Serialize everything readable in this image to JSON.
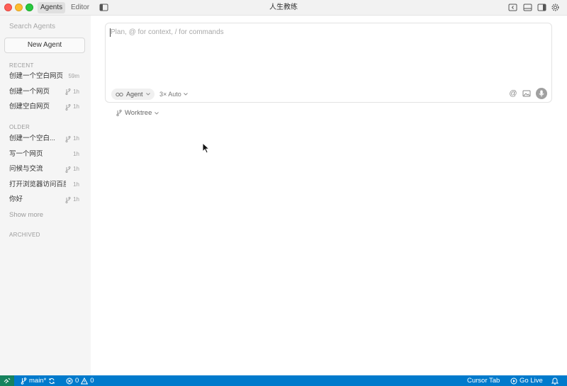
{
  "titlebar": {
    "title": "人生教练",
    "tabs": [
      {
        "label": "Agents",
        "active": true
      },
      {
        "label": "Editor",
        "active": false
      }
    ]
  },
  "sidebar": {
    "search_placeholder": "Search Agents",
    "new_agent_label": "New Agent",
    "sections": {
      "recent": "RECENT",
      "older": "OLDER",
      "archived": "ARCHIVED"
    },
    "recent_items": [
      {
        "label": "创建一个空白网页",
        "time": "59m",
        "branch": false
      },
      {
        "label": "创建一个网页",
        "time": "1h",
        "branch": true
      },
      {
        "label": "创建空白网页",
        "time": "1h",
        "branch": true
      }
    ],
    "older_items": [
      {
        "label": "创建一个空白...",
        "time": "1h",
        "branch": true
      },
      {
        "label": "写一个网页",
        "time": "1h",
        "branch": false
      },
      {
        "label": "问候与交流",
        "time": "1h",
        "branch": true
      },
      {
        "label": "打开浏览器访问百度",
        "time": "1h",
        "branch": false
      },
      {
        "label": "你好",
        "time": "1h",
        "branch": true
      }
    ],
    "show_more": "Show more"
  },
  "composer": {
    "placeholder": "Plan, @ for context, / for commands",
    "mode_label": "Agent",
    "model_label": "3× Auto",
    "at_symbol": "@",
    "worktree_label": "Worktree"
  },
  "statusbar": {
    "branch": "main*",
    "errors": "0",
    "warnings": "0",
    "cursor_tab": "Cursor Tab",
    "go_live": "Go Live"
  },
  "colors": {
    "statusbar_bg": "#007acc",
    "remote_bg": "#16825d",
    "sidebar_bg": "#f5f5f5"
  }
}
